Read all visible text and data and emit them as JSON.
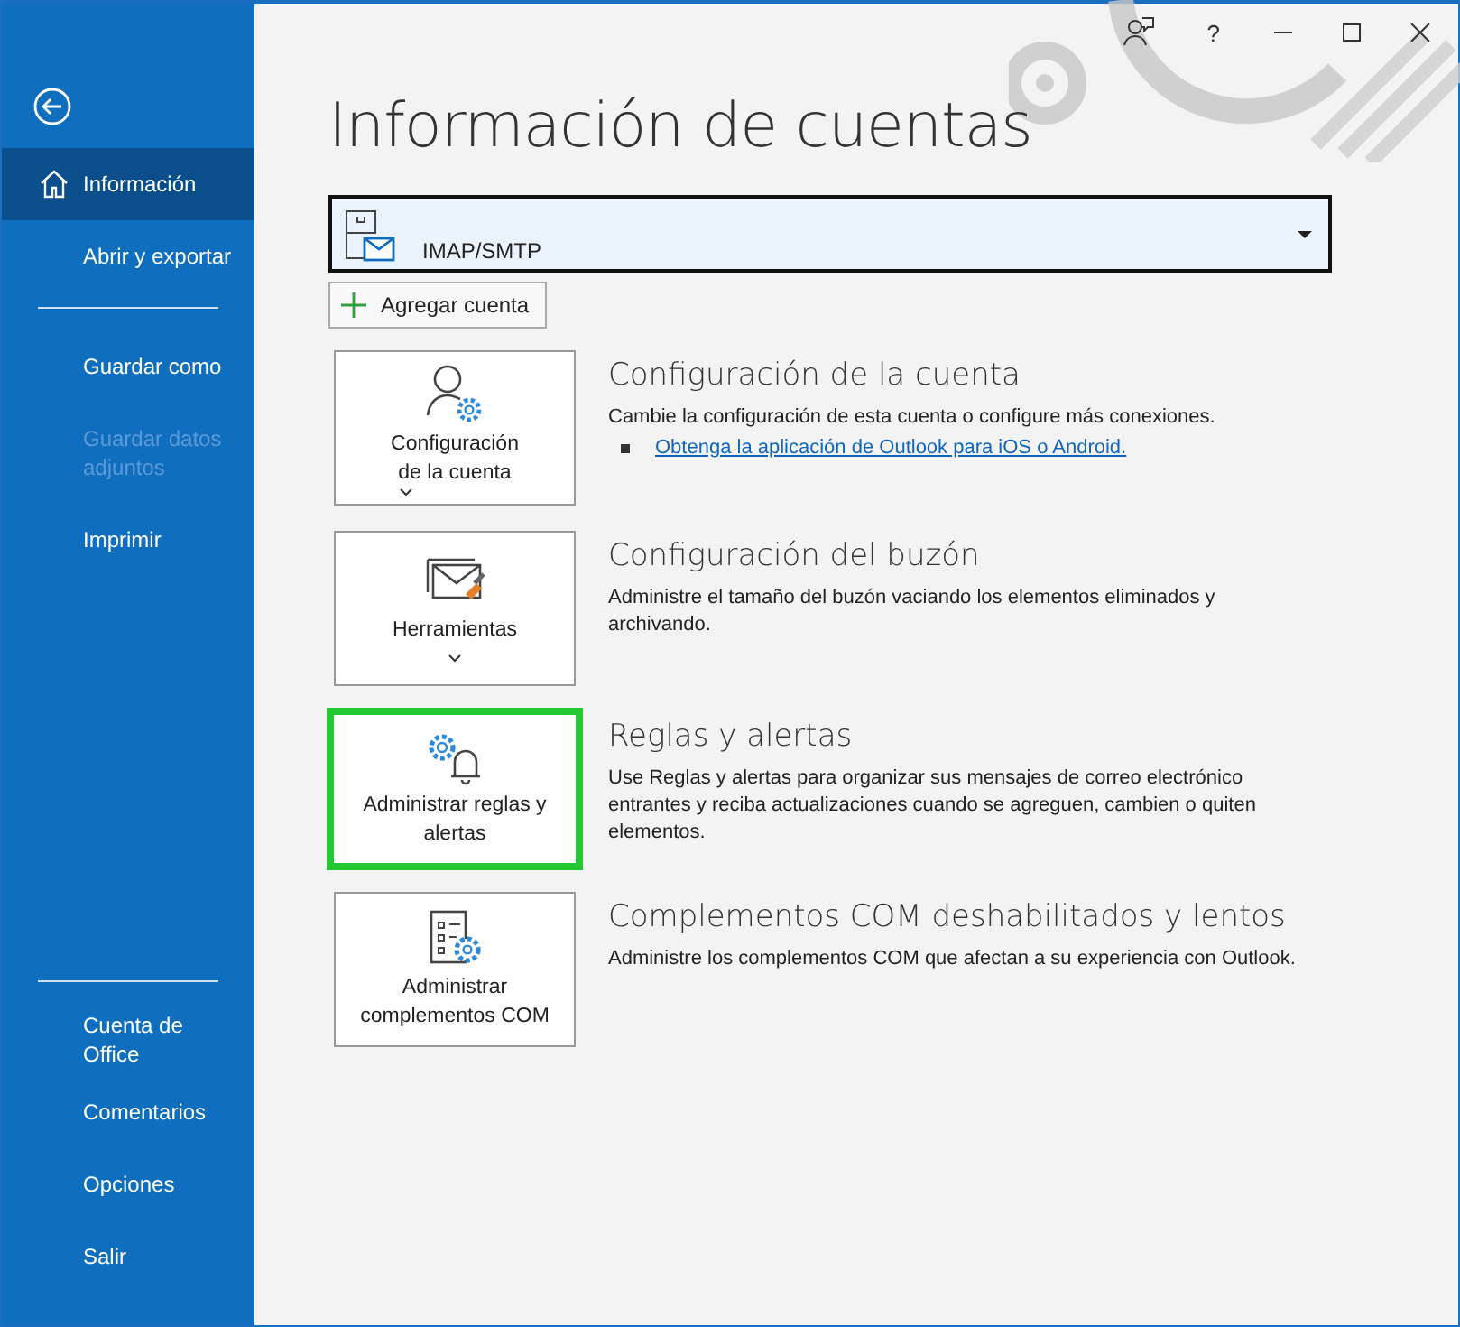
{
  "window_controls": {
    "help": "?"
  },
  "sidebar": {
    "top_items": [
      {
        "label": "Información",
        "selected": true,
        "disabled": false,
        "divider_after": false
      },
      {
        "label": "Abrir y exportar",
        "selected": false,
        "disabled": false,
        "divider_after": true
      },
      {
        "label": "Guardar como",
        "selected": false,
        "disabled": false,
        "divider_after": false
      },
      {
        "label": "Guardar datos adjuntos",
        "selected": false,
        "disabled": true,
        "divider_after": false
      },
      {
        "label": "Imprimir",
        "selected": false,
        "disabled": false,
        "divider_after": false
      }
    ],
    "bottom_items": [
      {
        "label": "Cuenta de Office",
        "selected": false,
        "disabled": false
      },
      {
        "label": "Comentarios",
        "selected": false,
        "disabled": false
      },
      {
        "label": "Opciones",
        "selected": false,
        "disabled": false
      },
      {
        "label": "Salir",
        "selected": false,
        "disabled": false
      }
    ]
  },
  "title": "Información de cuentas",
  "account_select": {
    "value": "IMAP/SMTP"
  },
  "add_account_button": "Agregar cuenta",
  "sections": [
    {
      "kind": "account",
      "button": [
        "Configuración",
        "de la cuenta"
      ],
      "has_menu": true,
      "highlighted": false,
      "heading": "Configuración de la cuenta",
      "description": "Cambie la configuración de esta cuenta o configure más conexiones.",
      "link": "Obtenga la aplicación de Outlook para iOS o Android."
    },
    {
      "kind": "tools",
      "button": [
        "Herramientas"
      ],
      "has_menu": true,
      "highlighted": false,
      "heading": "Configuración del buzón",
      "description": "Administre el tamaño del buzón vaciando los elementos eliminados y archivando."
    },
    {
      "kind": "rules",
      "button": [
        "Administrar reglas y",
        "alertas"
      ],
      "has_menu": false,
      "highlighted": true,
      "heading": "Reglas y alertas",
      "description": "Use Reglas y alertas para organizar sus mensajes de correo electrónico entrantes y reciba actualizaciones cuando se agreguen, cambien o quiten elementos."
    },
    {
      "kind": "com",
      "button": [
        "Administrar",
        "complementos COM"
      ],
      "has_menu": false,
      "highlighted": false,
      "heading": "Complementos COM deshabilitados y lentos",
      "description": "Administre los complementos COM que afectan a su experiencia con Outlook."
    }
  ]
}
